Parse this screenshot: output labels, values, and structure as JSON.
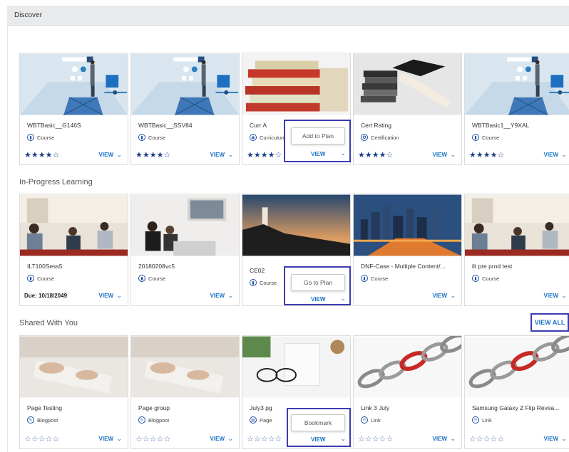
{
  "header": {
    "title": "Discover"
  },
  "sections": {
    "in_progress": "In-Progress Learning",
    "shared": "Shared With You",
    "view_all": "VIEW ALL"
  },
  "common": {
    "view": "VIEW"
  },
  "row1": [
    {
      "name": "WBTBasic__G146S",
      "type": "Course",
      "rating": "★★★★☆"
    },
    {
      "name": "WBTBasic__SSV84",
      "type": "Course",
      "rating": "★★★★☆"
    },
    {
      "name": "Curr A",
      "type": "Curriculum",
      "rating": "★★★★☆",
      "action": "Add to Plan"
    },
    {
      "name": "Cert Rating",
      "type": "Certification",
      "rating": "★★★★☆"
    },
    {
      "name": "WBTBasic1__Y9XAL",
      "type": "Course",
      "rating": "★★★★☆"
    }
  ],
  "row2": [
    {
      "name": "ILT100Sess5",
      "type": "Course",
      "due": "Due: 10/18/2049"
    },
    {
      "name": "20180208vc5",
      "type": "Course"
    },
    {
      "name": "CE02",
      "type": "Course",
      "action": "Go to Plan"
    },
    {
      "name": "DNF-Case - Multiple Content/...",
      "type": "Course"
    },
    {
      "name": "ilt pre prod test",
      "type": "Course"
    }
  ],
  "row3": [
    {
      "name": "Page Testing",
      "type": "Blogpost",
      "rating": "☆☆☆☆☆"
    },
    {
      "name": "Page group",
      "type": "Blogpost",
      "rating": "☆☆☆☆☆"
    },
    {
      "name": "July3 pg",
      "type": "Page",
      "rating": "☆☆☆☆☆",
      "action": "Bookmark"
    },
    {
      "name": "Link 3 July",
      "type": "Link",
      "rating": "☆☆☆☆☆"
    },
    {
      "name": "Samsung Galaxy Z Flip Revea...",
      "type": "Link",
      "rating": "☆☆☆☆☆"
    }
  ],
  "icons": {
    "course": "book-icon",
    "curriculum": "curriculum-icon",
    "certification": "certificate-icon",
    "blogpost": "blog-icon",
    "page": "page-icon",
    "link": "link-icon",
    "chevron": "chevron-down-icon"
  },
  "colors": {
    "accent": "#1a73c7",
    "highlight": "#3b3cb0",
    "stars": "#1d3f86"
  }
}
